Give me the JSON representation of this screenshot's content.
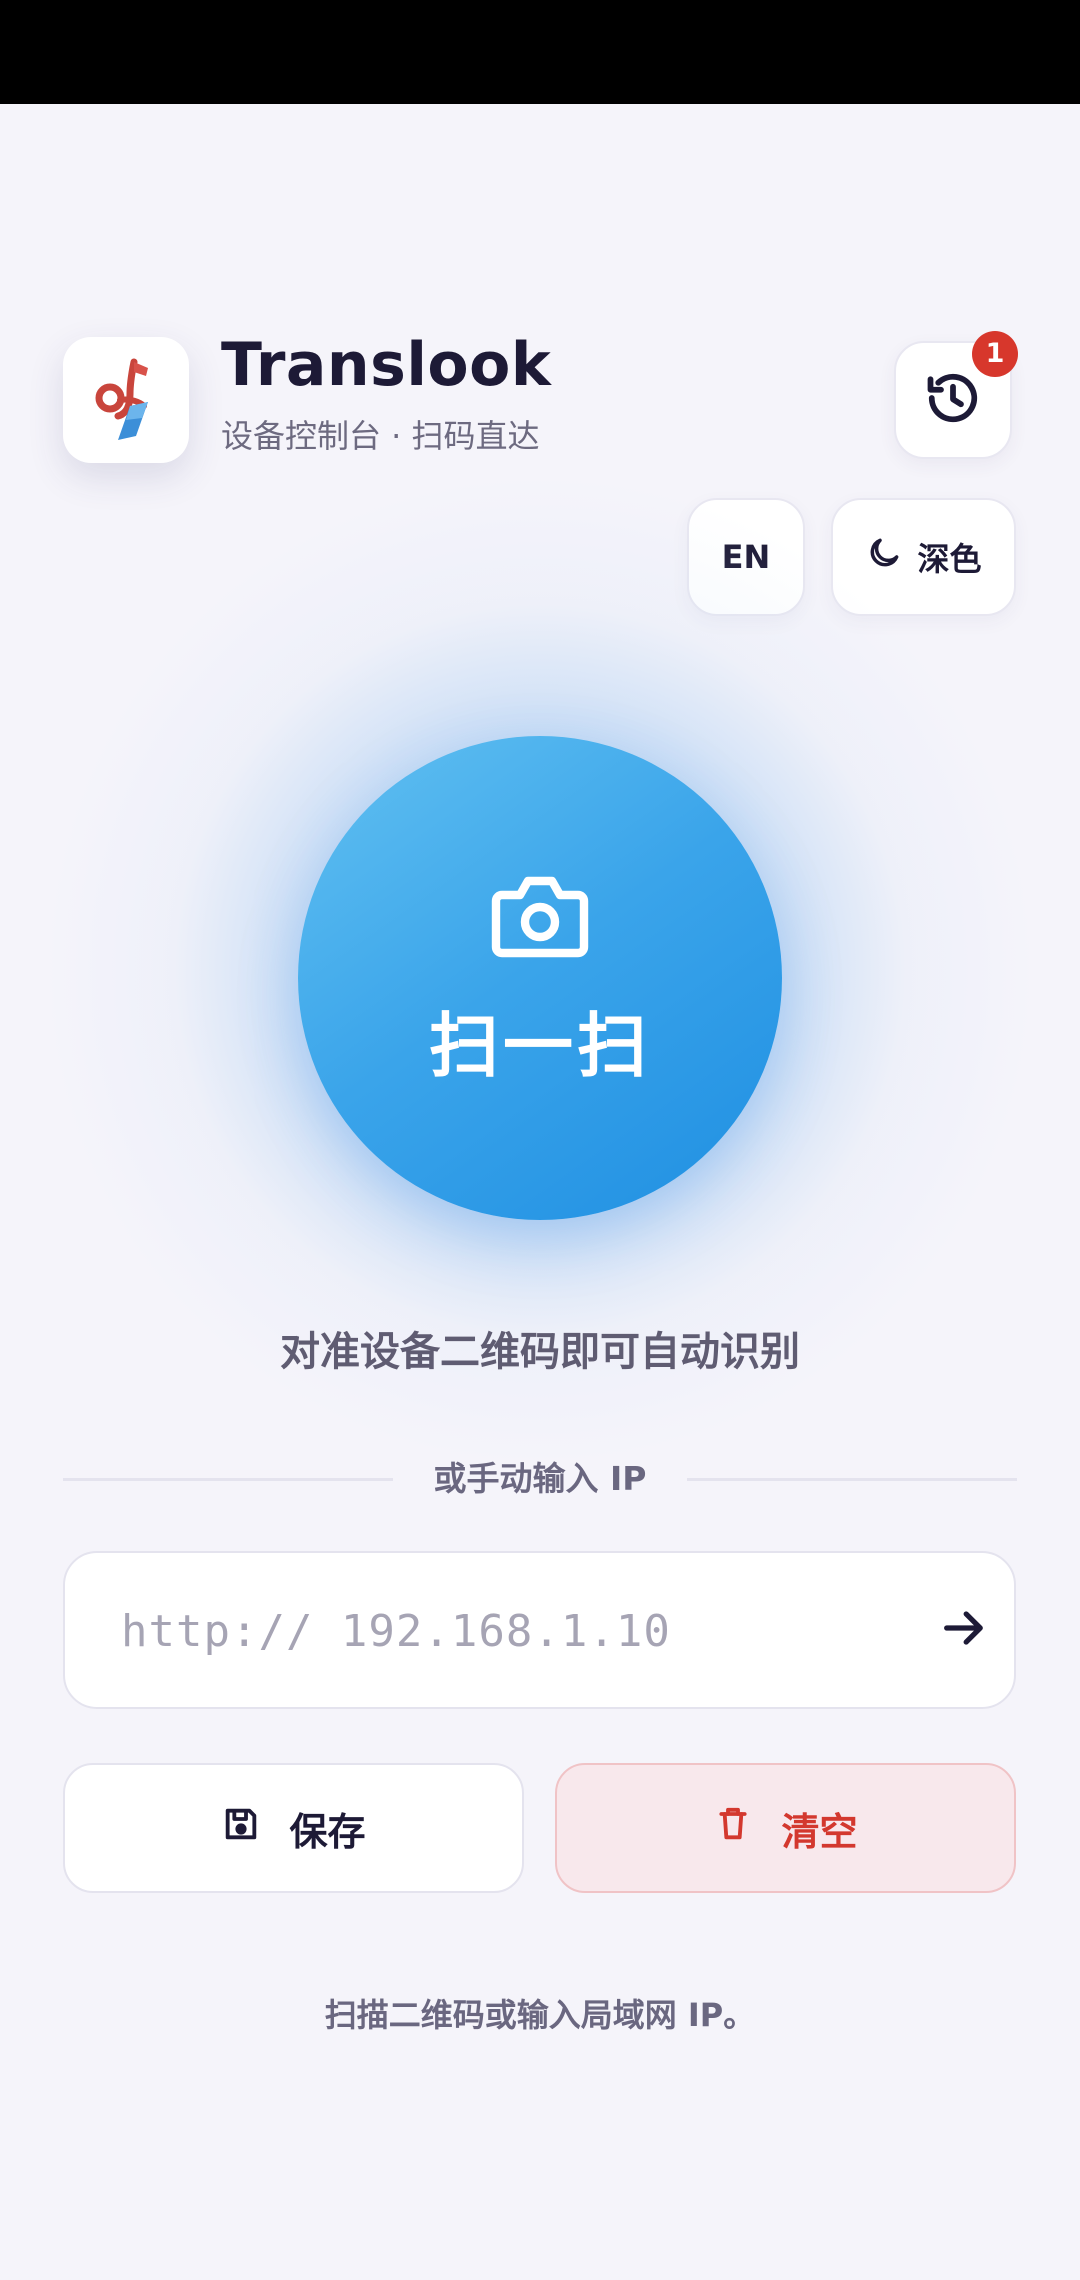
{
  "header": {
    "app_name": "Translook",
    "subtitle": "设备控制台 · 扫码直达",
    "logo_icon": "translook-logo-icon",
    "history_icon": "history-icon",
    "history_badge_count": "1"
  },
  "controls": {
    "language_label": "EN",
    "theme_label": "深色",
    "theme_icon": "moon-icon"
  },
  "scan": {
    "icon": "camera-icon",
    "label": "扫一扫",
    "hint": "对准设备二维码即可自动识别"
  },
  "manual": {
    "divider_text": "或手动输入 IP",
    "ip_placeholder": "http:// 192.168.1.10",
    "ip_value": "",
    "go_icon": "arrow-right-icon"
  },
  "actions": {
    "save_label": "保存",
    "save_icon": "save-icon",
    "clear_label": "清空",
    "clear_icon": "trash-icon"
  },
  "footer": {
    "note": "扫描二维码或输入局域网 IP。"
  },
  "colors": {
    "background": "#f5f4fa",
    "accent": "#3aa4ea",
    "danger": "#d3382e",
    "badge": "#d7372c"
  }
}
